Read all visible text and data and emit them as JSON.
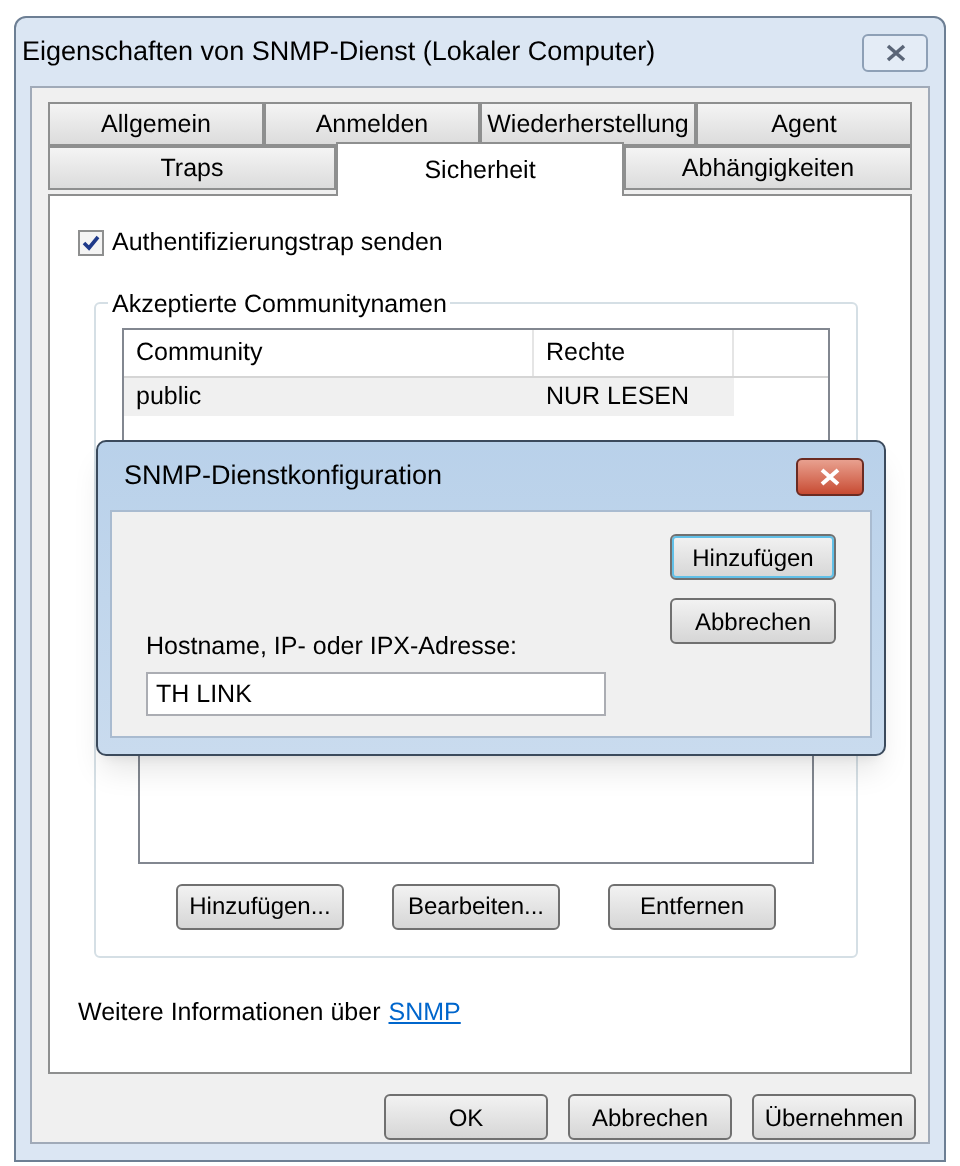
{
  "window": {
    "title": "Eigenschaften von SNMP-Dienst (Lokaler Computer)"
  },
  "tab_rows": [
    [
      {
        "label": "Allgemein",
        "selected": false
      },
      {
        "label": "Anmelden",
        "selected": false
      },
      {
        "label": "Wiederherstellung",
        "selected": false
      },
      {
        "label": "Agent",
        "selected": false
      }
    ],
    [
      {
        "label": "Traps",
        "selected": false
      },
      {
        "label": "Sicherheit",
        "selected": true
      },
      {
        "label": "Abhängigkeiten",
        "selected": false
      }
    ]
  ],
  "auth_trap": {
    "label": "Authentifizierungstrap senden",
    "checked": true
  },
  "communities": {
    "title": "Akzeptierte Communitynamen",
    "columns": [
      "Community",
      "Rechte"
    ],
    "rows": [
      {
        "community": "public",
        "rights": "NUR LESEN",
        "selected": true
      }
    ],
    "buttons": [
      "Hinzufügen...",
      "Bearbeiten...",
      "Entfernen"
    ]
  },
  "info": {
    "text": "Weitere Informationen über",
    "link": "SNMP"
  },
  "buttons": [
    "OK",
    "Abbrechen",
    "Übernehmen"
  ],
  "dialog": {
    "title": "SNMP-Dienstkonfiguration",
    "buttons": [
      {
        "label": "Hinzufügen",
        "focused": true
      },
      {
        "label": "Abbrechen",
        "focused": false
      }
    ],
    "field_label": "Hostname, IP- oder IPX-Adresse:",
    "field_value": "TH LINK"
  }
}
